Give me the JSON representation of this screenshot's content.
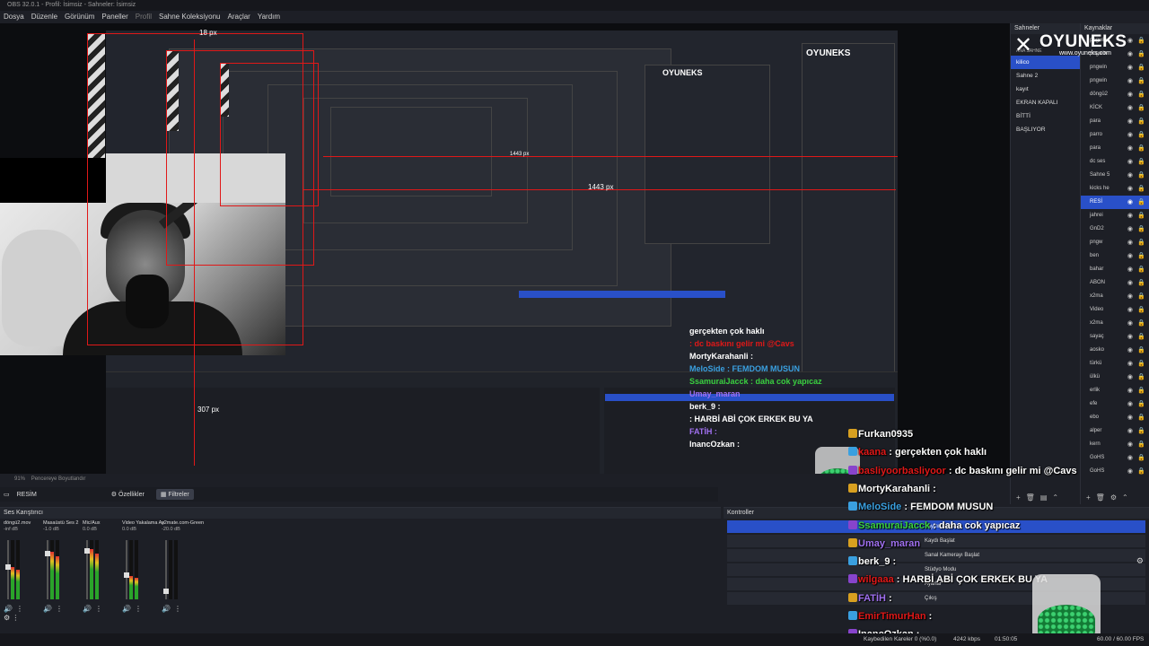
{
  "window": {
    "title": "OBS 32.0.1 - Profil: İsimsiz - Sahneler: İsimsiz"
  },
  "menu": [
    "Dosya",
    "Düzenle",
    "Görünüm",
    "Paneller",
    "Profil",
    "Sahne Koleksiyonu",
    "Araçlar",
    "Yardım"
  ],
  "preview": {
    "px_label_top": "18 px",
    "px_label_mid": "1443 px",
    "px_label_small": "1443 px",
    "mixer_px": "307 px",
    "zoom_text": "91%",
    "fit_text": "Pencereye Boyutlandır"
  },
  "logo": {
    "brand": "OYUNEKS",
    "site": "www.oyuneks.com"
  },
  "scenes": {
    "title": "Sahneler",
    "items": [
      {
        "label": "ANA SAHNE",
        "active": false
      },
      {
        "label": "kilico",
        "active": true
      },
      {
        "label": "Sahne 2",
        "active": false
      },
      {
        "label": "kayıt",
        "active": false
      },
      {
        "label": "EKRAN KAPALI",
        "active": false
      },
      {
        "label": "BİTTİ",
        "active": false
      },
      {
        "label": "BAŞLIYOR",
        "active": false
      }
    ]
  },
  "sources": {
    "title": "Kaynaklar",
    "items": [
      {
        "label": "pngwin",
        "active": false
      },
      {
        "label": "pngwin",
        "active": false
      },
      {
        "label": "pngwin",
        "active": false
      },
      {
        "label": "pngwin",
        "active": false
      },
      {
        "label": "döngü2",
        "active": false
      },
      {
        "label": "KİCK",
        "active": false
      },
      {
        "label": "para",
        "active": false
      },
      {
        "label": "parro",
        "active": false
      },
      {
        "label": "para",
        "active": false
      },
      {
        "label": "dc ses",
        "active": false
      },
      {
        "label": "Sahne 5",
        "active": false
      },
      {
        "label": "kicks he",
        "active": false
      },
      {
        "label": "RESİ",
        "active": true
      },
      {
        "label": "jahrei",
        "active": false
      },
      {
        "label": "GnD2",
        "active": false
      },
      {
        "label": "pngw",
        "active": false
      },
      {
        "label": "ben",
        "active": false
      },
      {
        "label": "bahar",
        "active": false
      },
      {
        "label": "ABON",
        "active": false
      },
      {
        "label": "x2ma",
        "active": false
      },
      {
        "label": "Video",
        "active": false
      },
      {
        "label": "x2ma",
        "active": false
      },
      {
        "label": "sayaç",
        "active": false
      },
      {
        "label": "aosko",
        "active": false
      },
      {
        "label": "türkü",
        "active": false
      },
      {
        "label": "ülkü",
        "active": false
      },
      {
        "label": "erlik",
        "active": false
      },
      {
        "label": "efe",
        "active": false
      },
      {
        "label": "ebo",
        "active": false
      },
      {
        "label": "alper",
        "active": false
      },
      {
        "label": "kern",
        "active": false
      },
      {
        "label": "GoHS",
        "active": false
      },
      {
        "label": "GoHS",
        "active": false
      }
    ]
  },
  "toolbar": {
    "source_name": "RESİM",
    "properties": "Özellikler",
    "filters": "Filtreler"
  },
  "mixer": {
    "title": "Ses Karıştırıcı",
    "channels": [
      {
        "name": "döngü2.mov",
        "db": "-inf dB",
        "level": 0.55
      },
      {
        "name": "Masaüstü Ses 2",
        "db": "-1.0 dB",
        "level": 0.8
      },
      {
        "name": "Mic/Aux",
        "db": "0.0 dB",
        "level": 0.85
      },
      {
        "name": "Video Yakalama Ay",
        "db": "0.0 dB",
        "level": 0.4
      },
      {
        "name": "x2mate.com-Green",
        "db": "-20.0 dB",
        "level": 0.0
      }
    ]
  },
  "controls": {
    "title": "Kontroller",
    "buttons": [
      {
        "label": "Yayını Başlat",
        "primary": true
      },
      {
        "label": "Kaydı Başlat",
        "primary": false
      },
      {
        "label": "Sanal Kamerayı Başlat",
        "primary": false
      },
      {
        "label": "Stüdyo Modu",
        "primary": false
      },
      {
        "label": "Ayarlar",
        "primary": false
      },
      {
        "label": "Çıkış",
        "primary": false
      }
    ]
  },
  "chat": [
    {
      "user": "Furkan0935",
      "text": "",
      "color": "#ffffff"
    },
    {
      "user": "kaana",
      "text": " : gerçekten çok haklı",
      "color": "#e01818"
    },
    {
      "user": "basliyoorbasliyoor",
      "text": " : dc baskını gelir mi @Cavs",
      "color": "#e01818"
    },
    {
      "user": "MortyKarahanli",
      "text": " :",
      "color": "#ffffff"
    },
    {
      "user": "MeloSide",
      "text": " : FEMDOM MUSUN",
      "color": "#3aa0e0"
    },
    {
      "user": "SsamuraiJacck",
      "text": " : daha cok yapıcaz",
      "color": "#3ad040"
    },
    {
      "user": "Umay_maran",
      "text": "",
      "color": "#a070f0"
    },
    {
      "user": "berk_9",
      "text": " :",
      "color": "#ffffff"
    },
    {
      "user": "wilgaaa",
      "text": " : HARBİ ABİ ÇOK ERKEK BU YA",
      "color": "#e01818"
    },
    {
      "user": "FATİH",
      "text": " :",
      "color": "#a070f0"
    },
    {
      "user": "EmirTimurHan",
      "text": " :",
      "color": "#e01818"
    },
    {
      "user": "InancOzkan",
      "text": " :",
      "color": "#ffffff"
    }
  ],
  "status": {
    "dropped": "Kaybedilen Kareler 0 (%0.0)",
    "bitrate": "4242 kbps",
    "time": "01:50:05",
    "fps": "60.00 / 60.00 FPS"
  }
}
